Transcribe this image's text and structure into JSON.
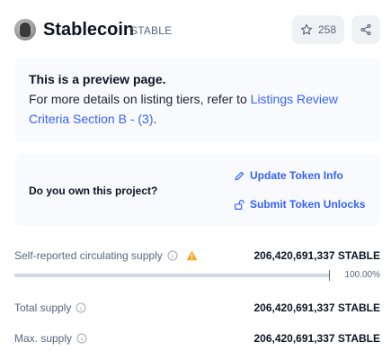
{
  "header": {
    "coin_name": "Stablecoin",
    "coin_symbol": "STABLE",
    "watchlist_count": "258"
  },
  "preview": {
    "title": "This is a preview page.",
    "text_prefix": "For more details on listing tiers, refer to ",
    "link_text": "Listings Review Criteria Section B - (3)",
    "text_suffix": "."
  },
  "ownership": {
    "question": "Do you own this project?",
    "update_link": "Update Token Info",
    "unlock_link": "Submit Token Unlocks"
  },
  "stats": {
    "circulating_label": "Self-reported circulating supply",
    "circulating_value": "206,420,691,337 STABLE",
    "circulating_percent": "100.00%",
    "circulating_fraction": 1.0,
    "total_label": "Total supply",
    "total_value": "206,420,691,337 STABLE",
    "max_label": "Max. supply",
    "max_value": "206,420,691,337 STABLE"
  },
  "colors": {
    "accent": "#3861fb",
    "muted_text": "#58667e",
    "warning": "#f5a623",
    "box_bg": "#f8fafd"
  },
  "icons": {
    "star": "star-icon",
    "share": "share-icon",
    "info": "info-icon",
    "warning": "warning-icon",
    "pencil": "pencil-icon",
    "unlock": "unlock-icon"
  }
}
